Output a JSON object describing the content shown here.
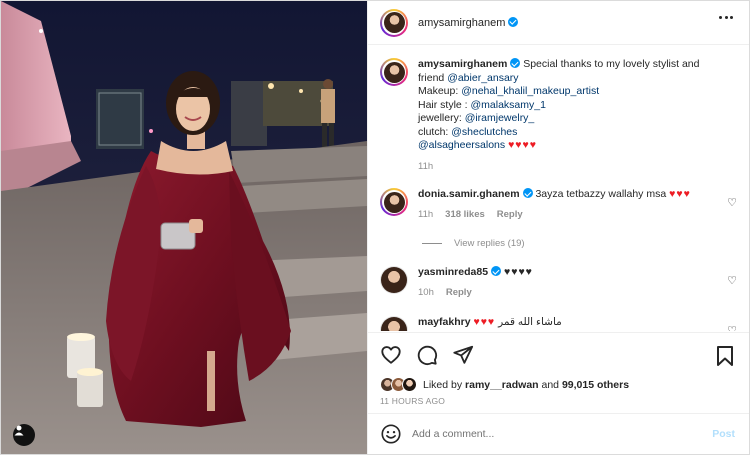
{
  "post": {
    "username": "amysamirghanem",
    "verified": true,
    "photo_alt": "Woman in burgundy satin off-shoulder gown with cape sleeves holding a silver clutch at night"
  },
  "caption": {
    "username": "amysamirghanem",
    "line1": "Special thanks to my lovely stylist and",
    "line2_prefix": "friend ",
    "mention_stylist": "@abier_ansary",
    "makeup_prefix": "Makeup: ",
    "mention_makeup": "@nehal_khalil_makeup_artist",
    "hair_prefix": "Hair style : ",
    "mention_hair": "@malaksamy_1",
    "jewellery_prefix": "jewellery: ",
    "mention_jewellery": "@iramjewelry_",
    "clutch_prefix": "clutch: ",
    "mention_clutch": "@sheclutches",
    "mention_salon": "@alsagheersalons",
    "salon_hearts": "♥♥♥♥",
    "time": "11h"
  },
  "comments": [
    {
      "username": "donia.samir.ghanem",
      "verified": true,
      "text": "3ayza tetbazzy wallahy msa",
      "hearts": "♥♥♥",
      "time": "11h",
      "likes": "318 likes",
      "reply": "Reply",
      "view_replies": "View replies (19)"
    },
    {
      "username": "yasminreda85",
      "verified": true,
      "text": "♥♥♥♥",
      "time": "10h",
      "reply": "Reply"
    },
    {
      "username": "mayfakhry",
      "verified": false,
      "hearts": "♥♥♥",
      "text": "ماشاء الله قمر"
    }
  ],
  "likes": {
    "prefix": "Liked by ",
    "user": "ramy__radwan",
    "middle": " and ",
    "count": "99,015 others"
  },
  "timestamp": "11 HOURS AGO",
  "add_comment": {
    "placeholder": "Add a comment...",
    "post_label": "Post"
  },
  "icons": {
    "more": "more-horizontal-icon",
    "like": "heart-outline-icon",
    "comment": "comment-bubble-icon",
    "share": "send-icon",
    "save": "bookmark-icon",
    "emoji": "emoji-icon",
    "tag": "user-tag-icon"
  },
  "colors": {
    "verified": "#0095f6",
    "link": "#00376b",
    "heart": "#ed1c24",
    "muted": "#8e8e8e",
    "post_disabled": "#b2dffc"
  }
}
